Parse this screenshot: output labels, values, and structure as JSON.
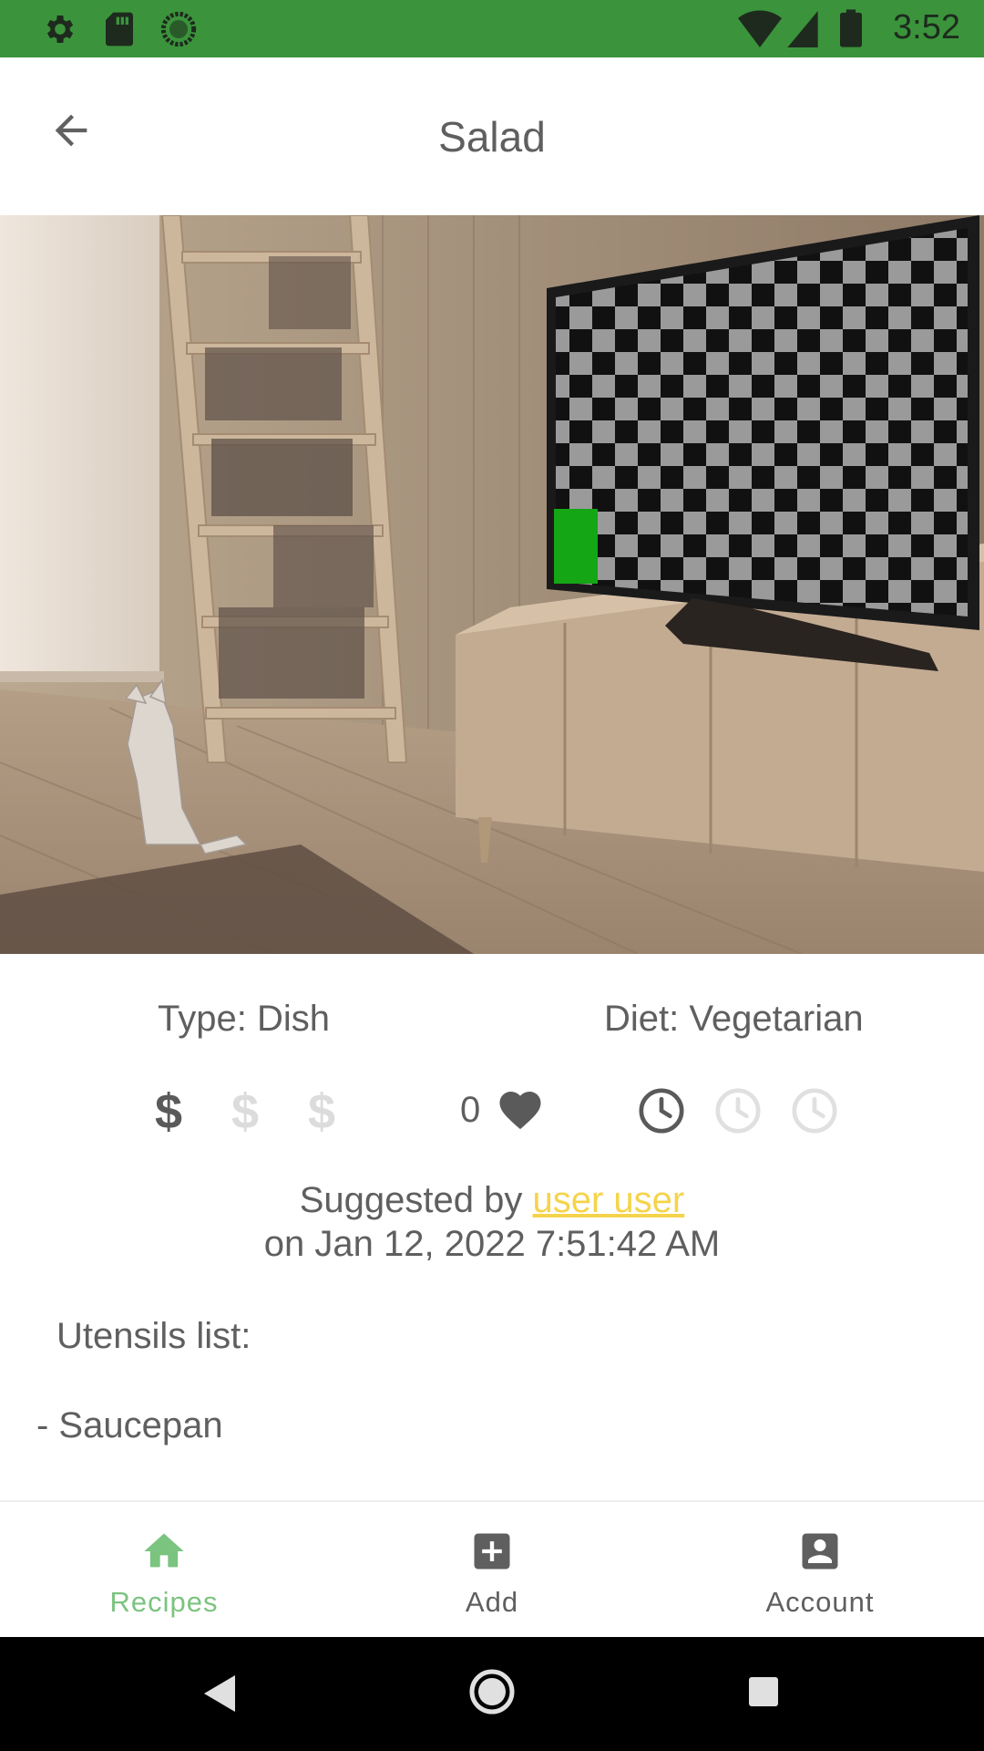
{
  "status_bar": {
    "time": "3:52",
    "left_icons": [
      "gear-icon",
      "sd-card-icon",
      "sync-circle-icon"
    ],
    "right_icons": [
      "wifi-icon",
      "signal-icon",
      "battery-icon"
    ],
    "background": "#3b943b"
  },
  "header": {
    "title": "Salad",
    "back_icon": "arrow-left-icon"
  },
  "recipe": {
    "type_label": "Type: Dish",
    "diet_label": "Diet: Vegetarian",
    "price": {
      "symbol": "$",
      "level": 1,
      "max": 3
    },
    "likes": "0",
    "time_level": {
      "level": 1,
      "max": 3
    },
    "suggested_prefix": "Suggested by ",
    "suggested_user": "user user",
    "suggested_date": "on Jan 12, 2022 7:51:42 AM",
    "utensils_title": "Utensils list:",
    "utensils": [
      "- Saucepan"
    ]
  },
  "bottom_nav": {
    "items": [
      {
        "label": "Recipes",
        "icon": "home-icon",
        "active": true
      },
      {
        "label": "Add",
        "icon": "add-box-icon",
        "active": false
      },
      {
        "label": "Account",
        "icon": "account-box-icon",
        "active": false
      }
    ],
    "active_color": "#7bc47f",
    "inactive_color": "#5f5f5f"
  },
  "system_nav": {
    "icons": [
      "back-triangle-icon",
      "home-circle-icon",
      "recents-square-icon"
    ]
  },
  "colors": {
    "link": "#f5d44b",
    "text": "#5f5f5f"
  }
}
